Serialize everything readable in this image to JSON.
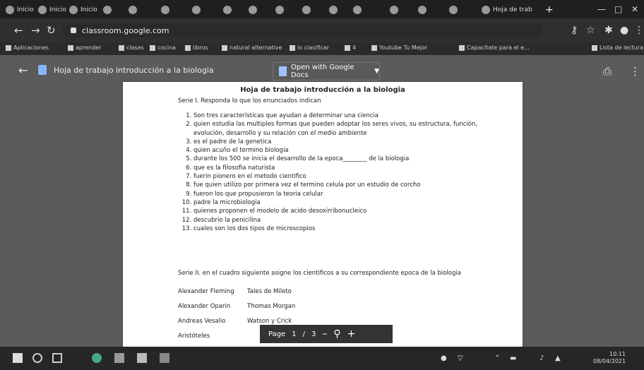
{
  "browser": {
    "tabs": [
      "Inicio",
      "Inicio",
      "Inicio",
      "",
      "",
      "",
      "",
      "",
      "",
      "",
      "",
      "",
      "",
      "",
      "",
      "",
      "Hoja de trab"
    ],
    "url": "classroom.google.com",
    "bookmarks": [
      "Aplicaciones",
      "aprender",
      "clases",
      "cocina",
      "libros",
      "natural alternative",
      "lo clasificar",
      "4",
      "Youtube Tu Mejor",
      "Capacitate para el e...",
      "Lista de lectura"
    ]
  },
  "viewer": {
    "doc_title": "Hoja de trabajo introducción a la biologia",
    "open_button": "Open with Google Docs"
  },
  "document": {
    "title": "Hoja de trabajo introducción a la biologia",
    "serie1": "Serie I. Responda lo que los enunciados indican",
    "items": [
      "Son tres características que ayudan a determinar una ciencia",
      "quien estudia las multiples formas que pueden adoptar los seres vivos, su estructura, función, evolución, desarrollo y su relación con el medio ambiente",
      "es el padre de la genetica",
      "quien acuño el termino biologia",
      "durante los 500 se inicia el desarrollo de la epoca________ de la biologia",
      "que es la filosofia naturista",
      "fuerin pionero en el metodo cientifico",
      "fue quien utilizo por primera vez el termino celula por un estudio de corcho",
      "fueron los que propusieron la teoria celular",
      "padre la microbiologia",
      "quienes proponen el modelo de acido desoxirribonucleico",
      "descubrio la penicilina",
      "cuales son los dos tipos de microscopios"
    ],
    "serie2": "Serie II. en el cuadro siguiente asigne los cientificos a su correspondiente epoca de la biologia",
    "col_left": [
      "Alexander Fleming",
      "Alexander Oparin",
      "Andreas Vesalio",
      "Aristóteles"
    ],
    "col_right": [
      "Tales de Mileto",
      "Thomas Morgan",
      "Watson y Crick"
    ]
  },
  "pagenav": {
    "label": "Page",
    "current": "1",
    "sep": "/",
    "total": "3"
  },
  "taskbar": {
    "time": "10:11",
    "date": "08/04/2021"
  }
}
